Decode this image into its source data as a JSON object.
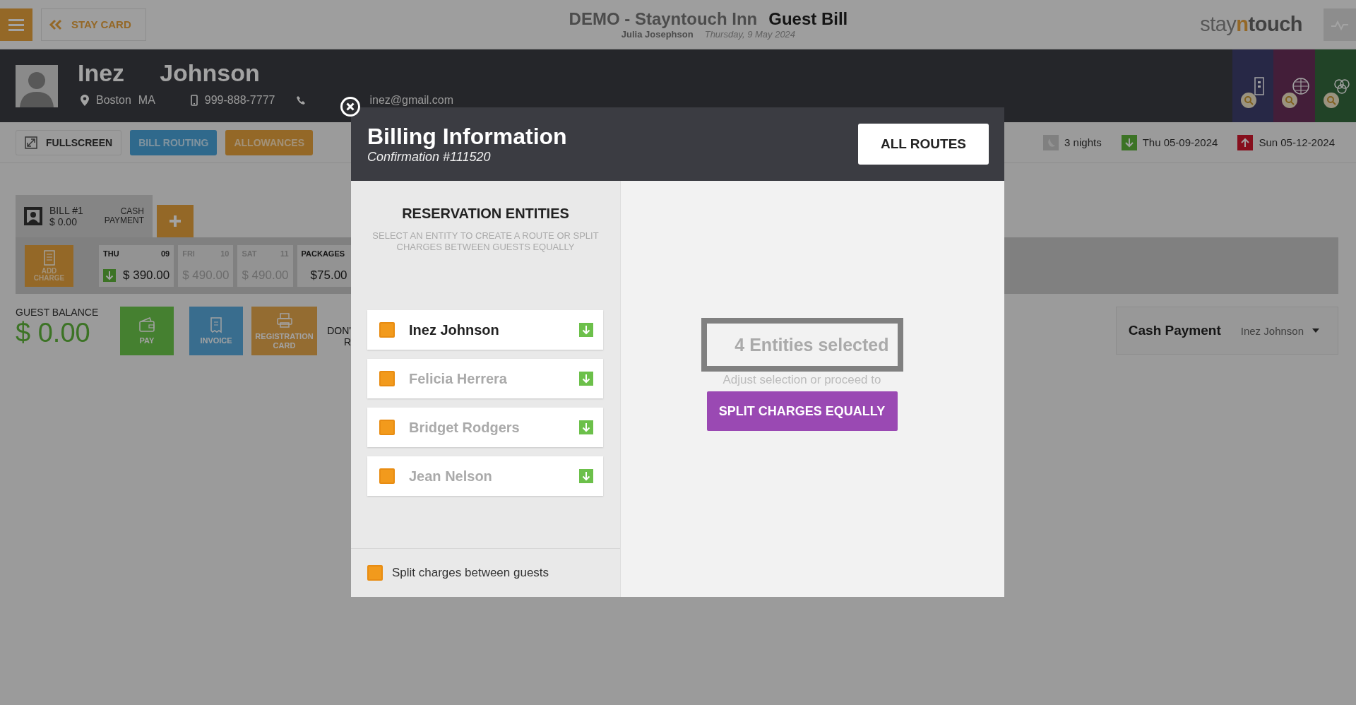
{
  "top_bar": {
    "back_label": "STAY CARD",
    "hotel": "DEMO - Stayntouch Inn",
    "page_title": "Guest Bill",
    "user": "Julia Josephson",
    "date": "Thursday, 9 May 2024",
    "logo": [
      "stay",
      "n",
      "touch"
    ]
  },
  "guest": {
    "first_name": "Inez",
    "last_name": "Johnson",
    "city": "Boston",
    "state": "MA",
    "phone": "999-888-7777",
    "email": "inez@gmail.com"
  },
  "toolbar": {
    "buttons": [
      {
        "label": "FULLSCREEN",
        "kind": "plain"
      },
      {
        "label": "BILL ROUTING",
        "kind": "blue"
      },
      {
        "label": "ALLOWANCES",
        "kind": "orange"
      }
    ],
    "nights": "3 nights",
    "arrival": "Thu 05-09-2024",
    "departure": "Sun 05-12-2024"
  },
  "bill": {
    "tab_label": "BILL #1",
    "tab_amount": "$ 0.00",
    "payment_type": [
      "CASH",
      "PAYMENT"
    ],
    "add_charge": [
      "ADD",
      "CHARGE"
    ],
    "days": [
      {
        "day": "THU",
        "date": "09",
        "amount": "$ 390.00",
        "selected": true,
        "arrival": true
      },
      {
        "day": "FRI",
        "date": "10",
        "amount": "$ 490.00",
        "selected": false,
        "arrival": false
      },
      {
        "day": "SAT",
        "date": "11",
        "amount": "$ 490.00",
        "selected": false,
        "arrival": false
      },
      {
        "day": "PACKAGES",
        "amount": "$75.00",
        "selected": true,
        "arrival": false
      }
    ],
    "balance_label": "GUEST BALANCE",
    "balance": "$ 0.00",
    "actions": [
      {
        "label": [
          "PAY"
        ],
        "kind": "pay"
      },
      {
        "label": [
          "INVOICE"
        ],
        "kind": "invoice"
      },
      {
        "label": [
          "REGISTRATION",
          "CARD"
        ],
        "kind": "registration"
      }
    ],
    "cut_label": [
      "DON'",
      "R"
    ],
    "payment": {
      "method": "Cash Payment",
      "guest": "Inez Johnson"
    }
  },
  "modal": {
    "title": "Billing Information",
    "subtitle": "Confirmation #111520",
    "all_routes": "ALL ROUTES",
    "entities_title": "RESERVATION ENTITIES",
    "entities_hint": "SELECT AN ENTITY TO CREATE A ROUTE OR SPLIT CHARGES BETWEEN GUESTS EQUALLY",
    "entities": [
      {
        "name": "Inez Johnson",
        "selected": true,
        "checked": true
      },
      {
        "name": "Felicia Herrera",
        "selected": false,
        "checked": true
      },
      {
        "name": "Bridget Rodgers",
        "selected": false,
        "checked": true
      },
      {
        "name": "Jean Nelson",
        "selected": false,
        "checked": true
      }
    ],
    "split_option": {
      "label": "Split charges between guests",
      "checked": true
    },
    "selection_count": "4 Entities selected",
    "selection_hint": "Adjust selection or proceed to",
    "split_button": "SPLIT CHARGES EQUALLY"
  }
}
